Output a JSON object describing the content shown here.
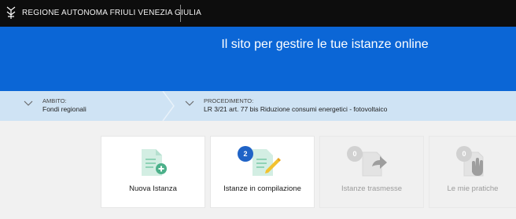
{
  "header": {
    "org_name": "REGIONE AUTONOMA FRIULI VENEZIA GIULIA"
  },
  "hero": {
    "title": "Il sito per gestire le tue istanze online"
  },
  "selectors": {
    "ambito": {
      "label": "AMBITO:",
      "value": "Fondi regionali"
    },
    "procedimento": {
      "label": "PROCEDIMENTO:",
      "value": "LR 3/21 art. 77 bis Riduzione consumi energetici - fotovoltaico"
    }
  },
  "cards": [
    {
      "label": "Nuova Istanza",
      "icon": "new-document-icon",
      "enabled": true
    },
    {
      "label": "Istanze in compilazione",
      "icon": "edit-document-icon",
      "count": "2",
      "enabled": true
    },
    {
      "label": "Istanze trasmesse",
      "icon": "send-document-icon",
      "count": "0",
      "enabled": false
    },
    {
      "label": "Le mie pratiche",
      "icon": "hand-document-icon",
      "count": "0",
      "enabled": false
    }
  ],
  "colors": {
    "topbar": "#0d0d0d",
    "hero_blue": "#0b66d6",
    "selector_band": "#cfe3f4",
    "icon_teal": "#4cb08a",
    "badge_blue": "#1f63c6",
    "disabled_gray": "#cfcfcf"
  }
}
